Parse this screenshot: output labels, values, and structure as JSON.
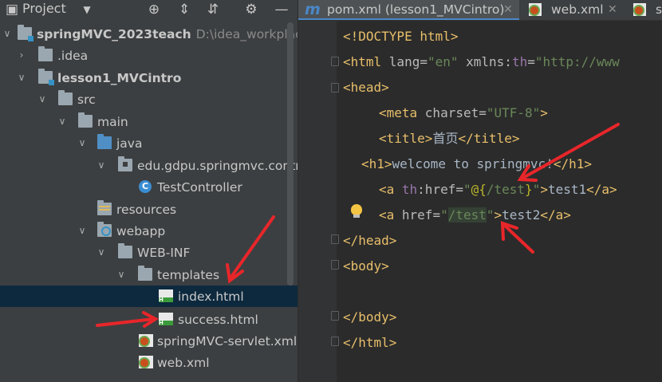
{
  "project_panel": {
    "title": "Project",
    "tree": [
      {
        "id": "root",
        "label": "springMVC_2023teach",
        "path": "D:\\idea_workplace\\s",
        "bold": true
      },
      {
        "id": "idea",
        "label": ".idea"
      },
      {
        "id": "lesson1",
        "label": "lesson1_MVCintro",
        "bold": true
      },
      {
        "id": "src",
        "label": "src"
      },
      {
        "id": "main",
        "label": "main"
      },
      {
        "id": "java",
        "label": "java"
      },
      {
        "id": "pkg",
        "label": "edu.gdpu.springmvc.contro"
      },
      {
        "id": "testcontroller",
        "label": "TestController"
      },
      {
        "id": "resources",
        "label": "resources"
      },
      {
        "id": "webapp",
        "label": "webapp"
      },
      {
        "id": "webinf",
        "label": "WEB-INF"
      },
      {
        "id": "templates",
        "label": "templates"
      },
      {
        "id": "indexhtml",
        "label": "index.html"
      },
      {
        "id": "successhtml",
        "label": "success.html"
      },
      {
        "id": "servletxml",
        "label": "springMVC-servlet.xml"
      },
      {
        "id": "webxml",
        "label": "web.xml"
      }
    ]
  },
  "editor": {
    "tabs": [
      {
        "label": "pom.xml (lesson1_MVCintro)",
        "icon": "maven-icon"
      },
      {
        "label": "web.xml",
        "icon": "xml-file-icon"
      },
      {
        "label": "sp",
        "icon": "xml-file-icon"
      }
    ],
    "code": {
      "l1": {
        "a": "<!DOCTYPE ",
        "b": "html",
        "c": ">"
      },
      "l2": {
        "a": "<html ",
        "b": "lang=",
        "c": "\"en\"",
        "d": " xmlns:",
        "e": "th",
        "f": "=",
        "g": "\"http://www"
      },
      "l3": {
        "a": "<head>"
      },
      "l4": {
        "a": "<meta ",
        "b": "charset=",
        "c": "\"UTF-8\"",
        "d": ">"
      },
      "l5": {
        "a": "<title>",
        "b": "首页",
        "c": "</title>"
      },
      "l6": {
        "a": "<h1>",
        "b": "welcome to springmvc!",
        "c": "</h1>"
      },
      "l7": {
        "a": "<a ",
        "b": "th",
        "c": ":href=",
        "d": "\"",
        "e": "@{",
        "f": "/test",
        "g": "}",
        "h": "\"",
        "i": ">",
        "j": "test1",
        "k": "</a>"
      },
      "l8": {
        "a": "<a ",
        "b": "href=",
        "c": "\"",
        "d": "/test",
        "e": "\"",
        "f": ">",
        "g": "test2",
        "h": "</a>"
      },
      "l9": {
        "a": "</head>"
      },
      "l10": {
        "a": "<body>"
      },
      "l11": {
        "a": "</body>"
      },
      "l12": {
        "a": "</html>"
      }
    }
  },
  "colors": {
    "arrow": "#e8262a",
    "tag": "#e8bf6a",
    "string": "#6a8759",
    "selection": "#0d293e"
  }
}
